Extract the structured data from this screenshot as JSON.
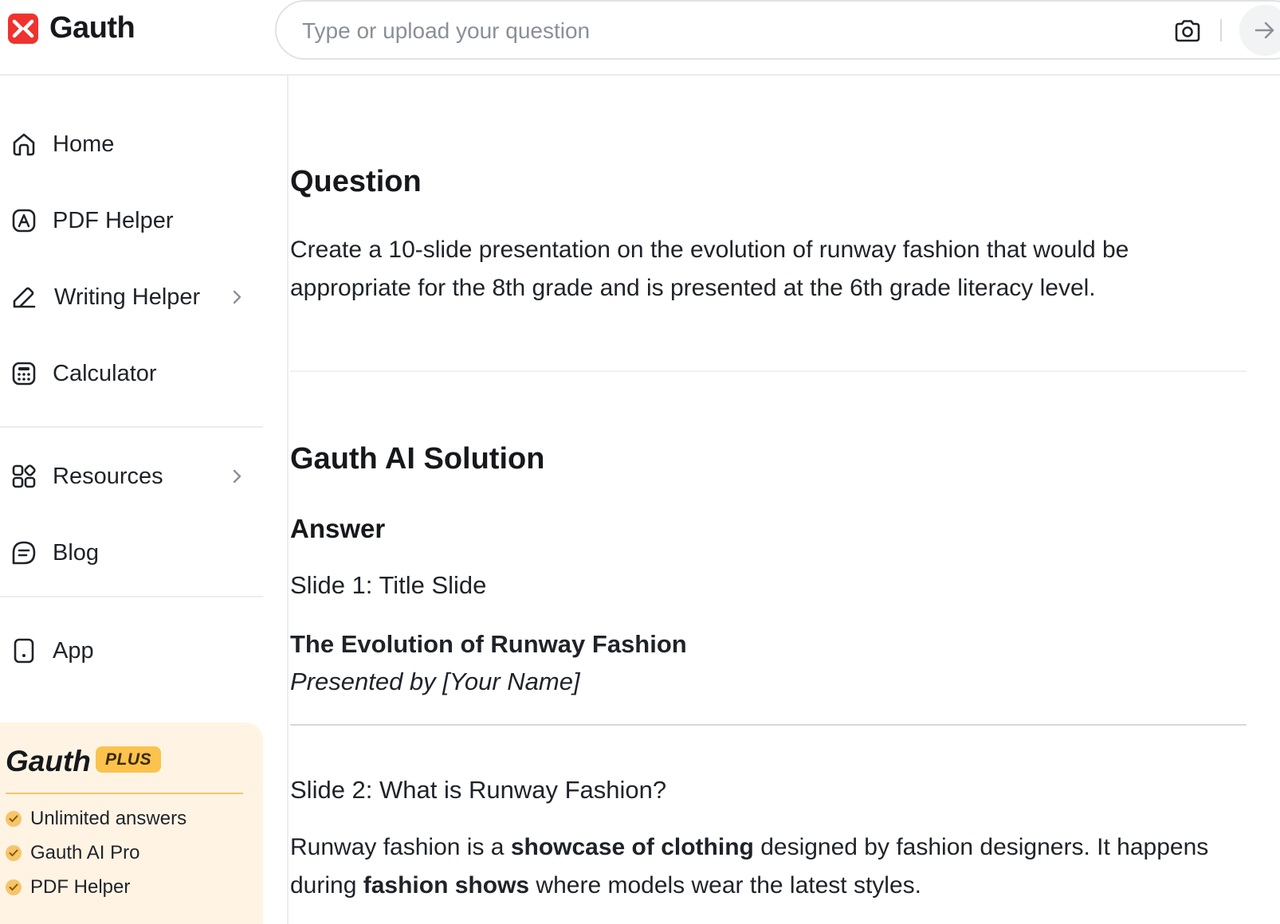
{
  "header": {
    "brand": "Gauth",
    "search": {
      "placeholder": "Type or upload your question"
    }
  },
  "sidebar": {
    "items": [
      {
        "label": "Home",
        "icon": "home-icon"
      },
      {
        "label": "PDF Helper",
        "icon": "pdf-icon"
      },
      {
        "label": "Writing Helper",
        "icon": "pen-icon"
      },
      {
        "label": "Calculator",
        "icon": "calculator-icon"
      },
      {
        "label": "Resources",
        "icon": "grid-icon"
      },
      {
        "label": "Blog",
        "icon": "blog-icon"
      },
      {
        "label": "App",
        "icon": "phone-icon"
      }
    ],
    "plus": {
      "brand": "Gauth",
      "badge": "PLUS",
      "features": [
        "Unlimited answers",
        "Gauth AI Pro",
        "PDF Helper"
      ]
    }
  },
  "main": {
    "question_heading": "Question",
    "question_text": "Create a 10-slide presentation on the evolution of runway fashion that would be appropriate for the 8th grade and is presented at the 6th grade literacy level.",
    "solution_heading": "Gauth AI Solution",
    "answer_heading": "Answer",
    "slide1": {
      "title": "Slide 1: Title Slide",
      "headline": "The Evolution of Runway Fashion",
      "byline": "Presented by [Your Name]"
    },
    "slide2": {
      "title": "Slide 2: What is Runway Fashion?",
      "p_start": "Runway fashion is a ",
      "p_bold1": "showcase of clothing",
      "p_mid": " designed by fashion designers. It happens during ",
      "p_bold2": "fashion shows",
      "p_end": " where models wear the latest styles."
    }
  },
  "colors": {
    "brand_red": "#f0322e",
    "plus_bg": "#fff4e4",
    "plus_badge": "#fbc24d"
  }
}
